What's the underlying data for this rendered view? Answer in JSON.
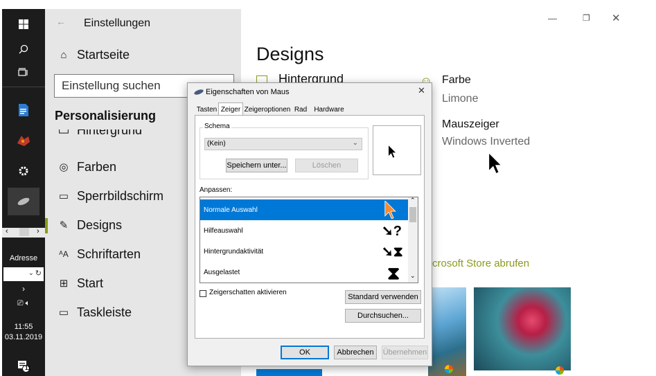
{
  "taskbar": {
    "address_label": "Adresse",
    "time": "11:55",
    "date": "03.11.2019",
    "notification_count": "11"
  },
  "settings": {
    "title": "Einstellungen",
    "home": "Startseite",
    "search_placeholder": "Einstellung suchen",
    "section": "Personalisierung",
    "nav": [
      {
        "label": "Hintergrund"
      },
      {
        "label": "Farben"
      },
      {
        "label": "Sperrbildschirm"
      },
      {
        "label": "Designs"
      },
      {
        "label": "Schriftarten"
      },
      {
        "label": "Start"
      },
      {
        "label": "Taskleiste"
      }
    ],
    "page_title": "Designs",
    "background_label": "Hintergrund",
    "color_label": "Farbe",
    "color_value": "Limone",
    "cursor_label": "Mauszeiger",
    "cursor_value": "Windows Inverted",
    "store_link": "crosoft Store abrufen"
  },
  "dialog": {
    "title": "Eigenschaften von Maus",
    "tabs": [
      "Tasten",
      "Zeiger",
      "Zeigeroptionen",
      "Rad",
      "Hardware"
    ],
    "active_tab": "Zeiger",
    "scheme_group": "Schema",
    "scheme_value": "(Kein)",
    "save_as": "Speichern unter...",
    "delete": "Löschen",
    "customize_label": "Anpassen:",
    "list": [
      {
        "label": "Normale Auswahl"
      },
      {
        "label": "Hilfeauswahl"
      },
      {
        "label": "Hintergrundaktivität"
      },
      {
        "label": "Ausgelastet"
      }
    ],
    "shadow_checkbox": "Zeigerschatten aktivieren",
    "use_default": "Standard verwenden",
    "browse": "Durchsuchen...",
    "ok": "OK",
    "cancel": "Abbrechen",
    "apply": "Übernehmen"
  },
  "colors": {
    "selection": "#0078d7",
    "store_link": "#8a9a1b",
    "taskbar": "#1c1c1c",
    "sidebar": "#e6e6e6"
  }
}
